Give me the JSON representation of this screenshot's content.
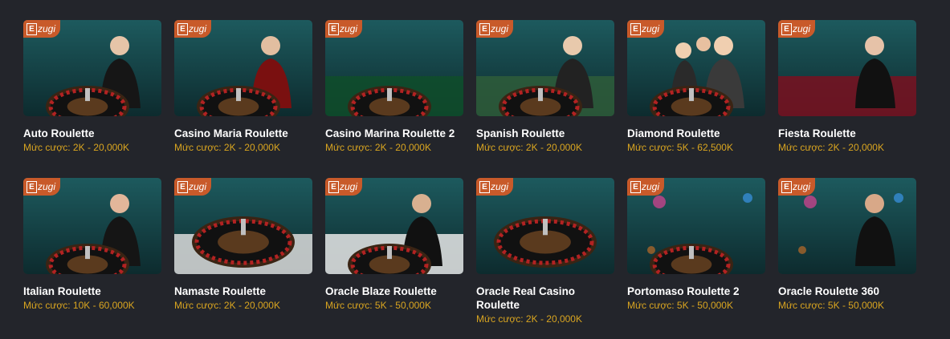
{
  "provider_badge": "zugi",
  "limit_prefix": "Mức cược:",
  "games": [
    {
      "title": "Auto Roulette",
      "limit": "Mức cược: 2K - 20,000K",
      "scene": "dealer-male-dark"
    },
    {
      "title": "Casino Maria Roulette",
      "limit": "Mức cược: 2K - 20,000K",
      "scene": "dealer-male-red"
    },
    {
      "title": "Casino Marina Roulette 2",
      "limit": "Mức cược: 2K - 20,000K",
      "scene": "table-green"
    },
    {
      "title": "Spanish Roulette",
      "limit": "Mức cược: 2K - 20,000K",
      "scene": "table-dealer"
    },
    {
      "title": "Diamond Roulette",
      "limit": "Mức cược: 5K - 62,500K",
      "scene": "players"
    },
    {
      "title": "Fiesta Roulette",
      "limit": "Mức cược: 2K - 20,000K",
      "scene": "fiesta"
    },
    {
      "title": "Italian Roulette",
      "limit": "Mức cược: 10K - 60,000K",
      "scene": "dealer-female"
    },
    {
      "title": "Namaste Roulette",
      "limit": "Mức cược: 2K - 20,000K",
      "scene": "wheel-wood"
    },
    {
      "title": "Oracle Blaze Roulette",
      "limit": "Mức cược: 5K - 50,000K",
      "scene": "oracle-blaze"
    },
    {
      "title": "Oracle Real Casino Roulette",
      "limit": "Mức cược: 2K - 20,000K",
      "scene": "wheel-dark"
    },
    {
      "title": "Portomaso Roulette 2",
      "limit": "Mức cược: 5K - 50,000K",
      "scene": "neon"
    },
    {
      "title": "Oracle Roulette 360",
      "limit": "Mức cược: 5K - 50,000K",
      "scene": "purple-dealer"
    }
  ]
}
